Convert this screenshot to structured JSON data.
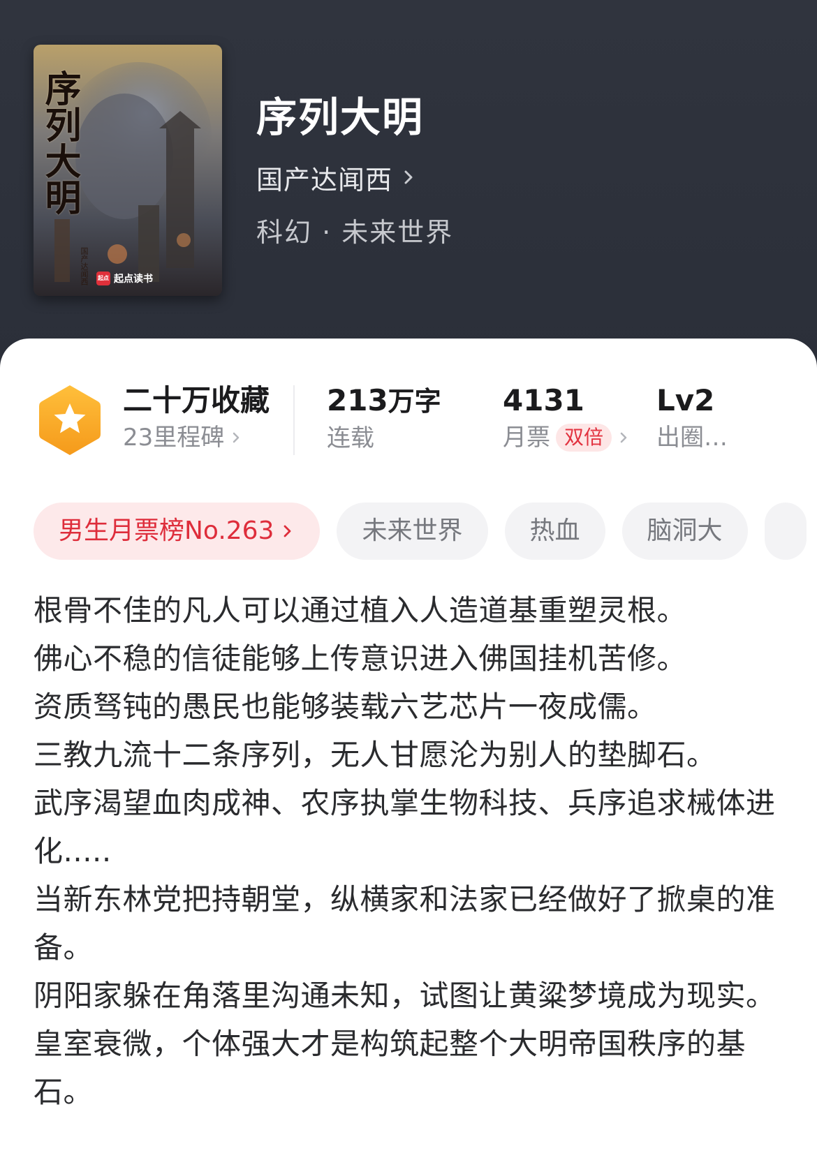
{
  "book": {
    "title": "序列大明",
    "author": "国产达闻西",
    "genre": "科幻 · 未来世界",
    "cover": {
      "title_text": "序列大明",
      "author_text": "国产达闻西",
      "publisher_logo": "起点",
      "publisher": "起点读书"
    }
  },
  "stats": {
    "collections": {
      "main": "二十万收藏",
      "sub": "23里程碑"
    },
    "words": {
      "number": "213",
      "unit": "万字",
      "sub": "连载"
    },
    "monthly_tickets": {
      "number": "4131",
      "sub": "月票",
      "badge": "双倍"
    },
    "level": {
      "main": "Lv2",
      "sub": "出圈…"
    }
  },
  "tags": [
    {
      "label": "男生月票榜No.263"
    },
    {
      "label": "未来世界"
    },
    {
      "label": "热血"
    },
    {
      "label": "脑洞大"
    }
  ],
  "synopsis": [
    "根骨不佳的凡人可以通过植入人造道基重塑灵根。",
    "佛心不稳的信徒能够上传意识进入佛国挂机苦修。",
    "资质驽钝的愚民也能够装载六艺芯片一夜成儒。",
    "三教九流十二条序列，无人甘愿沦为别人的垫脚石。",
    "武序渴望血肉成神、农序执掌生物科技、兵序追求械体进化.....",
    "当新东林党把持朝堂，纵横家和法家已经做好了掀桌的准备。",
    "阴阳家躲在角落里沟通未知，试图让黄粱梦境成为现实。",
    "皇室衰微，个体强大才是构筑起整个大明帝国秩序的基石。"
  ],
  "colors": {
    "header_bg": "#2d313b",
    "accent_red": "#de2d3b",
    "badge_orange": "#f5a623"
  }
}
